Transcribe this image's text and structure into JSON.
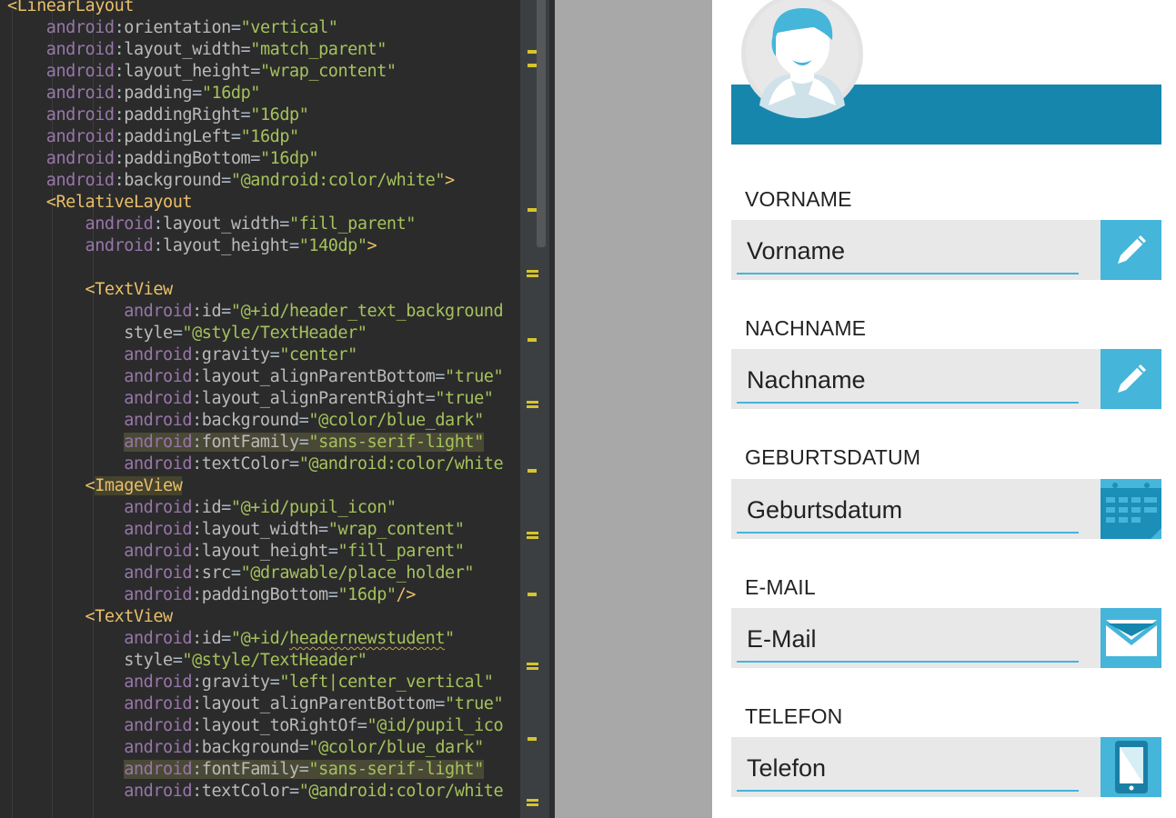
{
  "editor": {
    "lines": [
      [
        [
          "tag",
          "<LinearLayout"
        ]
      ],
      [
        [
          "ns",
          "    android"
        ],
        [
          "plain",
          ":"
        ],
        [
          "attr",
          "orientation"
        ],
        [
          "plain",
          "="
        ],
        [
          "val",
          "\"vertical\""
        ]
      ],
      [
        [
          "ns",
          "    android"
        ],
        [
          "plain",
          ":"
        ],
        [
          "attr",
          "layout_width"
        ],
        [
          "plain",
          "="
        ],
        [
          "val",
          "\"match_parent\""
        ]
      ],
      [
        [
          "ns",
          "    android"
        ],
        [
          "plain",
          ":"
        ],
        [
          "attr",
          "layout_height"
        ],
        [
          "plain",
          "="
        ],
        [
          "val",
          "\"wrap_content\""
        ]
      ],
      [
        [
          "ns",
          "    android"
        ],
        [
          "plain",
          ":"
        ],
        [
          "attr",
          "padding"
        ],
        [
          "plain",
          "="
        ],
        [
          "val",
          "\"16dp\""
        ]
      ],
      [
        [
          "ns",
          "    android"
        ],
        [
          "plain",
          ":"
        ],
        [
          "attr",
          "paddingRight"
        ],
        [
          "plain",
          "="
        ],
        [
          "val",
          "\"16dp\""
        ]
      ],
      [
        [
          "ns",
          "    android"
        ],
        [
          "plain",
          ":"
        ],
        [
          "attr",
          "paddingLeft"
        ],
        [
          "plain",
          "="
        ],
        [
          "val",
          "\"16dp\""
        ]
      ],
      [
        [
          "ns",
          "    android"
        ],
        [
          "plain",
          ":"
        ],
        [
          "attr",
          "paddingBottom"
        ],
        [
          "plain",
          "="
        ],
        [
          "val",
          "\"16dp\""
        ]
      ],
      [
        [
          "ns",
          "    android"
        ],
        [
          "plain",
          ":"
        ],
        [
          "attr",
          "background"
        ],
        [
          "plain",
          "="
        ],
        [
          "val",
          "\"@android:color/white\""
        ],
        [
          "tag",
          ">"
        ]
      ],
      [
        [
          "tag",
          "    <RelativeLayout"
        ]
      ],
      [
        [
          "ns",
          "        android"
        ],
        [
          "plain",
          ":"
        ],
        [
          "attr",
          "layout_width"
        ],
        [
          "plain",
          "="
        ],
        [
          "val",
          "\"fill_parent\""
        ]
      ],
      [
        [
          "ns",
          "        android"
        ],
        [
          "plain",
          ":"
        ],
        [
          "attr",
          "layout_height"
        ],
        [
          "plain",
          "="
        ],
        [
          "val",
          "\"140dp\""
        ],
        [
          "tag",
          ">"
        ]
      ],
      [],
      [
        [
          "tag",
          "        <TextView"
        ]
      ],
      [
        [
          "ns",
          "            android"
        ],
        [
          "plain",
          ":"
        ],
        [
          "attr",
          "id"
        ],
        [
          "plain",
          "="
        ],
        [
          "val",
          "\"@+id/header_text_background"
        ]
      ],
      [
        [
          "attr",
          "            style"
        ],
        [
          "plain",
          "="
        ],
        [
          "val",
          "\"@style/TextHeader\""
        ]
      ],
      [
        [
          "ns",
          "            android"
        ],
        [
          "plain",
          ":"
        ],
        [
          "attr",
          "gravity"
        ],
        [
          "plain",
          "="
        ],
        [
          "val",
          "\"center\""
        ]
      ],
      [
        [
          "ns",
          "            android"
        ],
        [
          "plain",
          ":"
        ],
        [
          "attr",
          "layout_alignParentBottom"
        ],
        [
          "plain",
          "="
        ],
        [
          "val",
          "\"true\""
        ]
      ],
      [
        [
          "ns",
          "            android"
        ],
        [
          "plain",
          ":"
        ],
        [
          "attr",
          "layout_alignParentRight"
        ],
        [
          "plain",
          "="
        ],
        [
          "val",
          "\"true\""
        ]
      ],
      [
        [
          "ns",
          "            android"
        ],
        [
          "plain",
          ":"
        ],
        [
          "attr",
          "background"
        ],
        [
          "plain",
          "="
        ],
        [
          "val",
          "\"@color/blue_dark\""
        ]
      ],
      [
        [
          "plain",
          "            "
        ],
        [
          "ns hl",
          "android"
        ],
        [
          "plain hl",
          ":"
        ],
        [
          "attr hl",
          "fontFamily"
        ],
        [
          "plain hl",
          "="
        ],
        [
          "val hl",
          "\"sans-serif-light\""
        ]
      ],
      [
        [
          "ns",
          "            android"
        ],
        [
          "plain",
          ":"
        ],
        [
          "attr",
          "textColor"
        ],
        [
          "plain",
          "="
        ],
        [
          "val",
          "\"@android:color/white"
        ]
      ],
      [
        [
          "tag",
          "        <"
        ],
        [
          "tag tag-hl",
          "ImageView"
        ]
      ],
      [
        [
          "ns",
          "            android"
        ],
        [
          "plain",
          ":"
        ],
        [
          "attr",
          "id"
        ],
        [
          "plain",
          "="
        ],
        [
          "val",
          "\"@+id/pupil_icon\""
        ]
      ],
      [
        [
          "ns",
          "            android"
        ],
        [
          "plain",
          ":"
        ],
        [
          "attr",
          "layout_width"
        ],
        [
          "plain",
          "="
        ],
        [
          "val",
          "\"wrap_content\""
        ]
      ],
      [
        [
          "ns",
          "            android"
        ],
        [
          "plain",
          ":"
        ],
        [
          "attr",
          "layout_height"
        ],
        [
          "plain",
          "="
        ],
        [
          "val",
          "\"fill_parent\""
        ]
      ],
      [
        [
          "ns",
          "            android"
        ],
        [
          "plain",
          ":"
        ],
        [
          "attr",
          "src"
        ],
        [
          "plain",
          "="
        ],
        [
          "val",
          "\"@drawable/place_holder\""
        ]
      ],
      [
        [
          "ns",
          "            android"
        ],
        [
          "plain",
          ":"
        ],
        [
          "attr",
          "paddingBottom"
        ],
        [
          "plain",
          "="
        ],
        [
          "val",
          "\"16dp\""
        ],
        [
          "tag",
          "/>"
        ]
      ],
      [
        [
          "tag",
          "        <TextView"
        ]
      ],
      [
        [
          "ns",
          "            android"
        ],
        [
          "plain",
          ":"
        ],
        [
          "attr",
          "id"
        ],
        [
          "plain",
          "="
        ],
        [
          "val",
          "\"@+id/"
        ],
        [
          "val squig",
          "headernewstudent"
        ],
        [
          "val",
          "\""
        ]
      ],
      [
        [
          "attr",
          "            style"
        ],
        [
          "plain",
          "="
        ],
        [
          "val",
          "\"@style/TextHeader\""
        ]
      ],
      [
        [
          "ns",
          "            android"
        ],
        [
          "plain",
          ":"
        ],
        [
          "attr",
          "gravity"
        ],
        [
          "plain",
          "="
        ],
        [
          "val",
          "\"left|center_vertical\""
        ]
      ],
      [
        [
          "ns",
          "            android"
        ],
        [
          "plain",
          ":"
        ],
        [
          "attr",
          "layout_alignParentBottom"
        ],
        [
          "plain",
          "="
        ],
        [
          "val",
          "\"true\""
        ]
      ],
      [
        [
          "ns",
          "            android"
        ],
        [
          "plain",
          ":"
        ],
        [
          "attr",
          "layout_toRightOf"
        ],
        [
          "plain",
          "="
        ],
        [
          "val",
          "\"@id/pupil_ico"
        ]
      ],
      [
        [
          "ns",
          "            android"
        ],
        [
          "plain",
          ":"
        ],
        [
          "attr",
          "background"
        ],
        [
          "plain",
          "="
        ],
        [
          "val",
          "\"@color/blue_dark\""
        ]
      ],
      [
        [
          "plain",
          "            "
        ],
        [
          "ns hl",
          "android"
        ],
        [
          "plain hl",
          ":"
        ],
        [
          "attr hl",
          "fontFamily"
        ],
        [
          "plain hl",
          "="
        ],
        [
          "val hl",
          "\"sans-serif-light\""
        ]
      ],
      [
        [
          "ns",
          "            android"
        ],
        [
          "plain",
          ":"
        ],
        [
          "attr",
          "textColor"
        ],
        [
          "plain",
          "="
        ],
        [
          "val",
          "\"@android:color/white"
        ]
      ]
    ]
  },
  "form": {
    "fields": [
      {
        "label": "VORNAME",
        "placeholder": "Vorname",
        "icon": "pencil-icon"
      },
      {
        "label": "NACHNAME",
        "placeholder": "Nachname",
        "icon": "pencil-icon"
      },
      {
        "label": "GEBURTSDATUM",
        "placeholder": "Geburtsdatum",
        "icon": "calendar-icon"
      },
      {
        "label": "E-MAIL",
        "placeholder": "E-Mail",
        "icon": "envelope-icon"
      },
      {
        "label": "TELEFON",
        "placeholder": "Telefon",
        "icon": "phone-icon"
      }
    ]
  },
  "colors": {
    "header": "#1686ad",
    "button": "#45b5da",
    "field_bg": "#e8e8e9",
    "underline": "#44b4dd"
  }
}
